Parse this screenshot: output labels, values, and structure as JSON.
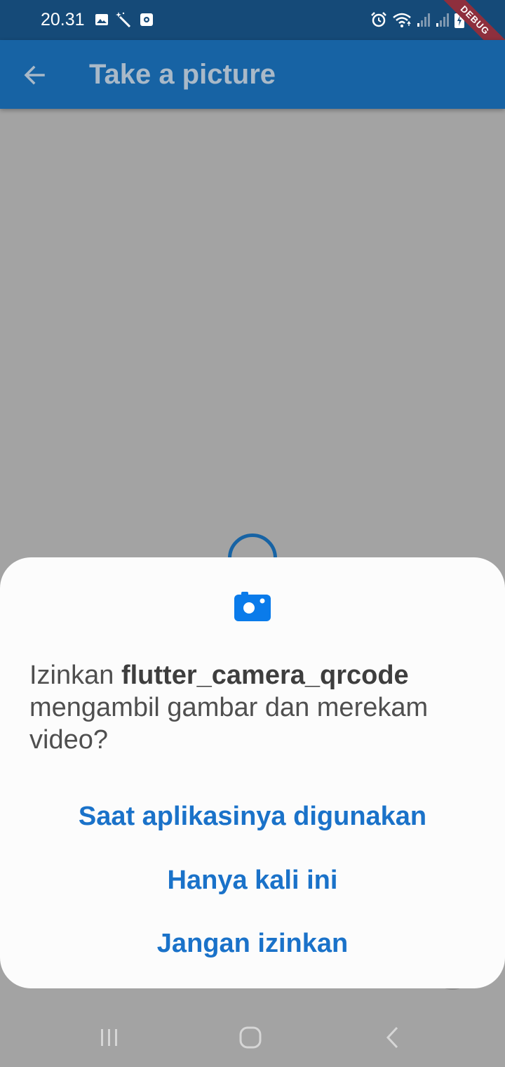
{
  "status_bar": {
    "time": "20.31",
    "icons_left": [
      "image-icon",
      "magic-wand-icon",
      "screen-record-icon"
    ],
    "icons_right": [
      "alarm-icon",
      "wifi-icon",
      "signal-icon",
      "signal-icon",
      "battery-charging-icon"
    ],
    "debug_label": "DEBUG"
  },
  "app_bar": {
    "title": "Take a picture",
    "back_icon": "arrow-back-icon"
  },
  "permission_dialog": {
    "icon": "camera-icon",
    "message_prefix": "Izinkan ",
    "app_name": "flutter_camera_qrcode",
    "message_suffix": " mengambil gambar dan merekam video?",
    "options": [
      "Saat aplikasinya digunakan",
      "Hanya kali ini",
      "Jangan izinkan"
    ]
  },
  "nav_bar": {
    "buttons": [
      "recent-apps-icon",
      "home-icon",
      "back-icon"
    ]
  },
  "colors": {
    "status_bar": "#154a78",
    "app_bar": "#1763a4",
    "accent": "#1a72c9",
    "scrim": "#a3a3a3"
  }
}
